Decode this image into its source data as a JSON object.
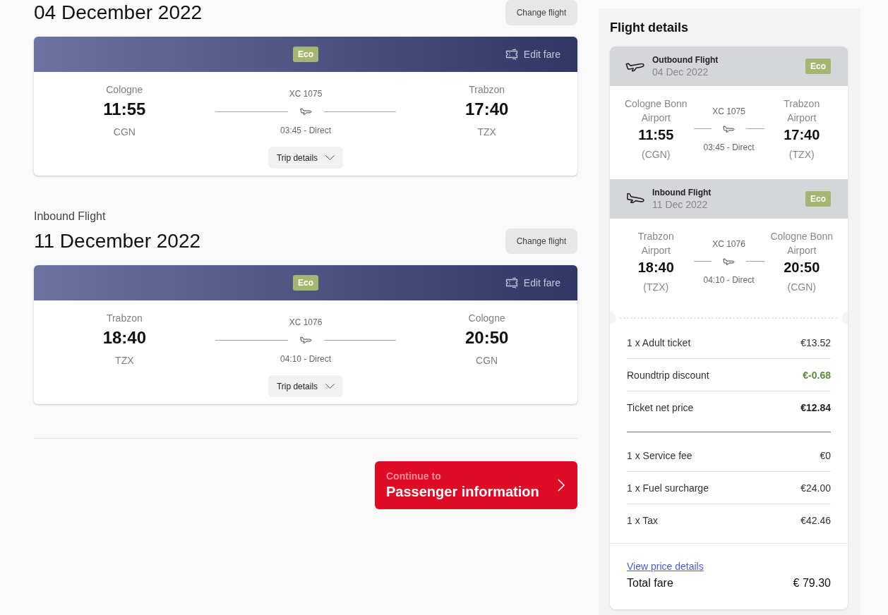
{
  "flights": [
    {
      "date_heading": "04 December 2022",
      "change_button": "Change flight",
      "fare_class": "Eco",
      "edit_fare": "Edit fare",
      "origin": {
        "city": "Cologne",
        "time": "11:55",
        "code": "CGN"
      },
      "flight_number": "XC 1075",
      "duration": "03:45 - Direct",
      "destination": {
        "city": "Trabzon",
        "time": "17:40",
        "code": "TZX"
      },
      "trip_details": {
        "label": "Trip details",
        "expanded": false
      }
    },
    {
      "label": "Inbound Flight",
      "date_heading": "11 December 2022",
      "change_button": "Change flight",
      "fare_class": "Eco",
      "edit_fare": "Edit fare",
      "origin": {
        "city": "Trabzon",
        "time": "18:40",
        "code": "TZX"
      },
      "flight_number": "XC 1076",
      "duration": "04:10 - Direct",
      "destination": {
        "city": "Cologne",
        "time": "20:50",
        "code": "CGN"
      },
      "trip_details": {
        "label": "Trip details",
        "expanded": false
      }
    }
  ],
  "continue_button": {
    "caption": "Continue to",
    "label": "Passenger information"
  },
  "summary": {
    "title": "Flight details",
    "legs": [
      {
        "kind": "departure",
        "title": "Outbound Flight",
        "date": "04 Dec 2022",
        "fare_class": "Eco",
        "origin": {
          "airport": "Cologne Bonn Airport",
          "time": "11:55",
          "code": "(CGN)"
        },
        "flight_number": "XC 1075",
        "duration": "03:45 - Direct",
        "destination": {
          "airport": "Trabzon Airport",
          "time": "17:40",
          "code": "(TZX)"
        }
      },
      {
        "kind": "arrival",
        "title": "Inbound Flight",
        "date": "11 Dec 2022",
        "fare_class": "Eco",
        "origin": {
          "airport": "Trabzon Airport",
          "time": "18:40",
          "code": "(TZX)"
        },
        "flight_number": "XC 1076",
        "duration": "04:10 - Direct",
        "destination": {
          "airport": "Cologne Bonn Airport",
          "time": "20:50",
          "code": "(CGN)"
        }
      }
    ],
    "price_groups": [
      {
        "rows": [
          {
            "kind": "item",
            "label": "1 x Adult ticket",
            "value": "€13.52"
          },
          {
            "kind": "discount",
            "label": "Roundtrip discount",
            "value": "€-0.68"
          },
          {
            "kind": "subtotal",
            "label": "Ticket net price",
            "value": "€12.84"
          }
        ]
      },
      {
        "rows": [
          {
            "kind": "item",
            "label": "1 x Service fee",
            "value": "€0"
          },
          {
            "kind": "item",
            "label": "1 x Fuel surcharge",
            "value": "€24.00"
          },
          {
            "kind": "item",
            "label": "1 x Tax",
            "value": "€42.46"
          }
        ]
      }
    ],
    "price_details_link": "View price details",
    "total": {
      "label": "Total fare",
      "value": "€ 79.30"
    }
  }
}
